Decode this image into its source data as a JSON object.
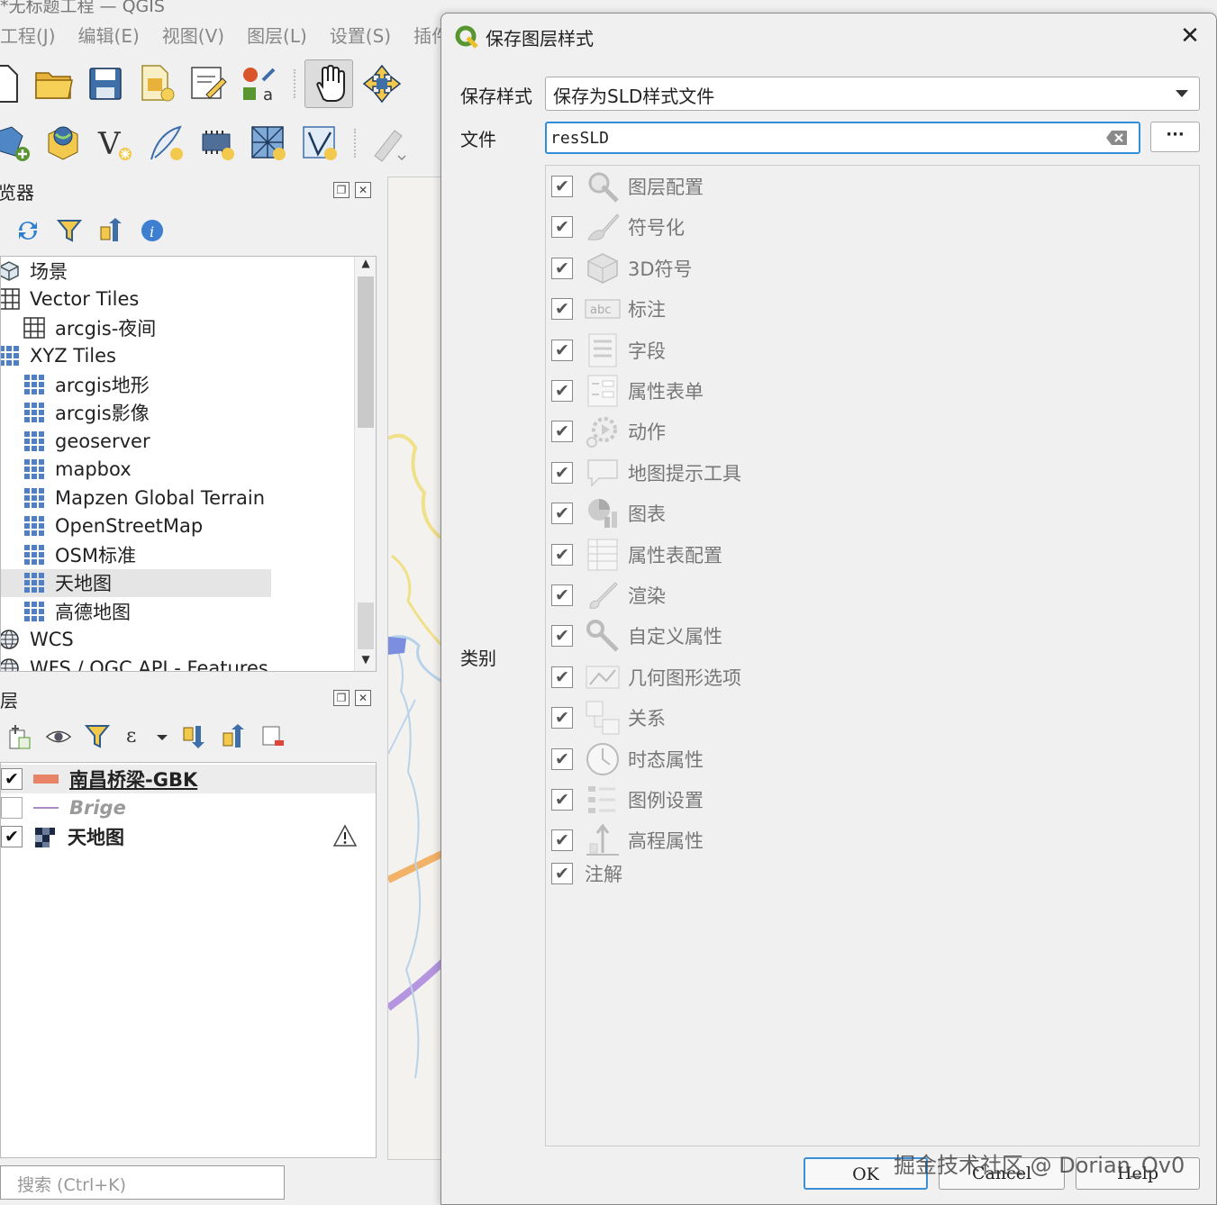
{
  "window": {
    "title": "*无标题工程 — QGIS",
    "menu": [
      "工程(J)",
      "编辑(E)",
      "视图(V)",
      "图层(L)",
      "设置(S)",
      "插件("
    ]
  },
  "browser_panel": {
    "title": "浏览器",
    "items": [
      {
        "label": "场景",
        "icon": "scene-cube-icon",
        "indent": 0
      },
      {
        "label": "Vector Tiles",
        "icon": "vector-tiles-grid-icon",
        "indent": 0
      },
      {
        "label": "arcgis-夜间",
        "icon": "vector-tiles-grid-icon",
        "indent": 1
      },
      {
        "label": "XYZ Tiles",
        "icon": "xyz-tiles-icon",
        "indent": 0
      },
      {
        "label": "arcgis地形",
        "icon": "xyz-tiles-icon",
        "indent": 1
      },
      {
        "label": "arcgis影像",
        "icon": "xyz-tiles-icon",
        "indent": 1
      },
      {
        "label": "geoserver",
        "icon": "xyz-tiles-icon",
        "indent": 1
      },
      {
        "label": "mapbox",
        "icon": "xyz-tiles-icon",
        "indent": 1
      },
      {
        "label": "Mapzen Global Terrain",
        "icon": "xyz-tiles-icon",
        "indent": 1
      },
      {
        "label": "OpenStreetMap",
        "icon": "xyz-tiles-icon",
        "indent": 1
      },
      {
        "label": "OSM标准",
        "icon": "xyz-tiles-icon",
        "indent": 1
      },
      {
        "label": "天地图",
        "icon": "xyz-tiles-icon",
        "indent": 1,
        "selected": true
      },
      {
        "label": "高德地图",
        "icon": "xyz-tiles-icon",
        "indent": 1
      },
      {
        "label": "WCS",
        "icon": "globe-icon",
        "indent": 0
      },
      {
        "label": "WFS / OGC API - Features",
        "icon": "globe-icon",
        "indent": 0
      }
    ]
  },
  "layers_panel": {
    "title": "图层",
    "layers": [
      {
        "label": "南昌桥梁-GBK",
        "checked": true,
        "bold": true,
        "underline": true,
        "italic": false,
        "symbol_color": "#e8603c",
        "icon": "polygon-symbol-icon"
      },
      {
        "label": "Brige",
        "checked": false,
        "bold": true,
        "underline": false,
        "italic": true,
        "symbol_color": "#a98bc7",
        "icon": "line-symbol-icon"
      },
      {
        "label": "天地图",
        "checked": true,
        "bold": true,
        "underline": false,
        "italic": false,
        "symbol_color": "#1a2a44",
        "icon": "raster-symbol-icon",
        "warning": true
      }
    ]
  },
  "search": {
    "placeholder": "搜索 (Ctrl+K)"
  },
  "dialog": {
    "title": "保存图层样式",
    "save_style_label": "保存样式",
    "save_style_value": "保存为SLD样式文件",
    "file_label": "文件",
    "file_value": "resSLD",
    "browse_label": "···",
    "category_label": "类别",
    "categories": [
      {
        "label": "图层配置",
        "checked": true,
        "icon": "layer-config-icon"
      },
      {
        "label": "符号化",
        "checked": true,
        "icon": "symbology-brush-icon"
      },
      {
        "label": "3D符号",
        "checked": true,
        "icon": "cube-3d-icon"
      },
      {
        "label": "标注",
        "checked": true,
        "icon": "labels-abc-icon"
      },
      {
        "label": "字段",
        "checked": true,
        "icon": "fields-icon"
      },
      {
        "label": "属性表单",
        "checked": true,
        "icon": "attribute-form-icon"
      },
      {
        "label": "动作",
        "checked": true,
        "icon": "actions-gear-icon"
      },
      {
        "label": "地图提示工具",
        "checked": true,
        "icon": "map-tips-bubble-icon"
      },
      {
        "label": "图表",
        "checked": true,
        "icon": "diagram-icon"
      },
      {
        "label": "属性表配置",
        "checked": true,
        "icon": "attribute-table-icon"
      },
      {
        "label": "渲染",
        "checked": true,
        "icon": "rendering-brush-icon"
      },
      {
        "label": "自定义属性",
        "checked": true,
        "icon": "custom-properties-wrench-icon"
      },
      {
        "label": "几何图形选项",
        "checked": true,
        "icon": "geometry-options-icon"
      },
      {
        "label": "关系",
        "checked": true,
        "icon": "relations-icon"
      },
      {
        "label": "时态属性",
        "checked": true,
        "icon": "temporal-clock-icon"
      },
      {
        "label": "图例设置",
        "checked": true,
        "icon": "legend-icon"
      },
      {
        "label": "高程属性",
        "checked": true,
        "icon": "elevation-icon"
      },
      {
        "label": "注解",
        "checked": true,
        "icon": ""
      }
    ],
    "ok_label": "OK",
    "cancel_label": "Cancel",
    "help_label": "Help"
  },
  "watermark": "掘金技术社区 @ Dorian_Ov0",
  "colors": {
    "accent": "#3a8fd6",
    "qgis_green": "#589632",
    "qgis_yellow": "#eebf2c"
  }
}
